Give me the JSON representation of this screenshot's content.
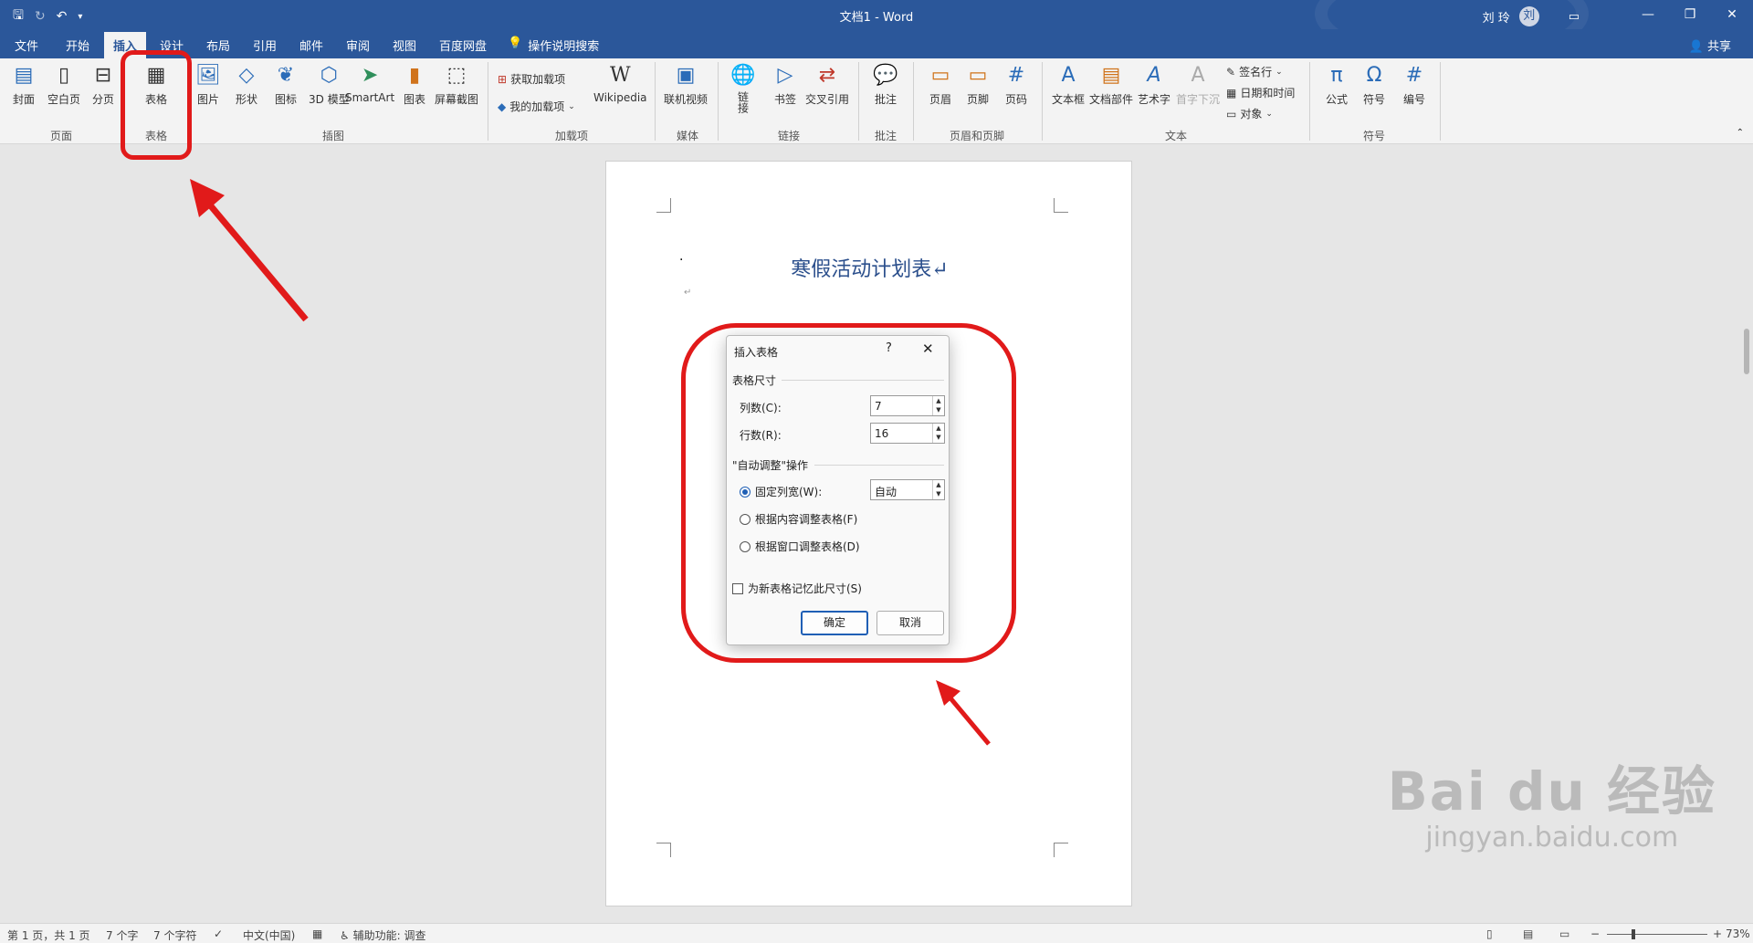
{
  "titlebar": {
    "doc_title": "文档1  -  Word",
    "user_name": "刘 玲",
    "user_initial": "刘"
  },
  "tabs": {
    "items": [
      "文件",
      "开始",
      "插入",
      "设计",
      "布局",
      "引用",
      "邮件",
      "审阅",
      "视图",
      "百度网盘"
    ],
    "active": "插入",
    "search": "操作说明搜索",
    "share": "共享"
  },
  "ribbon": {
    "page_group": {
      "label": "页面",
      "cover": "封面",
      "blank": "空白页",
      "break": "分页"
    },
    "table_group": {
      "label": "表格",
      "table": "表格"
    },
    "illus_group": {
      "label": "插图",
      "picture": "图片",
      "shapes": "形状",
      "icons": "图标",
      "model3d": "3D 模型",
      "smartart": "SmartArt",
      "chart": "图表",
      "screenshot": "屏幕截图"
    },
    "addins_group": {
      "label": "加载项",
      "get": "获取加载项",
      "mine": "我的加载项",
      "wiki": "Wikipedia"
    },
    "media_group": {
      "label": "媒体",
      "video": "联机视频"
    },
    "links_group": {
      "label": "链接",
      "link": "链接",
      "bookmark": "书签",
      "xref": "交叉引用"
    },
    "comments_group": {
      "label": "批注",
      "comment": "批注"
    },
    "hf_group": {
      "label": "页眉和页脚",
      "header": "页眉",
      "footer": "页脚",
      "pagenum": "页码"
    },
    "text_group": {
      "label": "文本",
      "textbox": "文本框",
      "parts": "文档部件",
      "wordart": "艺术字",
      "dropcap": "首字下沉",
      "sigline": "签名行",
      "datetime": "日期和时间",
      "object": "对象"
    },
    "symbols_group": {
      "label": "符号",
      "equation": "公式",
      "symbol": "符号",
      "number": "编号"
    }
  },
  "document": {
    "title": "寒假活动计划表↵",
    "para_mark": "↵"
  },
  "dialog": {
    "title": "插入表格",
    "help": "?",
    "close": "✕",
    "size_section": "表格尺寸",
    "cols_label": "列数(C):",
    "cols_value": "7",
    "rows_label": "行数(R):",
    "rows_value": "16",
    "autofit_section": "\"自动调整\"操作",
    "fixed_label": "固定列宽(W):",
    "fixed_value": "自动",
    "content_label": "根据内容调整表格(F)",
    "window_label": "根据窗口调整表格(D)",
    "remember_label": "为新表格记忆此尺寸(S)",
    "ok": "确定",
    "cancel": "取消"
  },
  "statusbar": {
    "page": "第 1 页，共 1 页",
    "words": "7 个字",
    "chars": "7 个字符",
    "lang": "中文(中国)",
    "access": "辅助功能: 调查",
    "zoom": "73%"
  },
  "watermark": {
    "main": "Bai du 经验",
    "sub": "jingyan.baidu.com"
  },
  "colors": {
    "brand": "#2b579a",
    "annotation": "#e11a1a",
    "doc_title": "#2b4f8c"
  }
}
